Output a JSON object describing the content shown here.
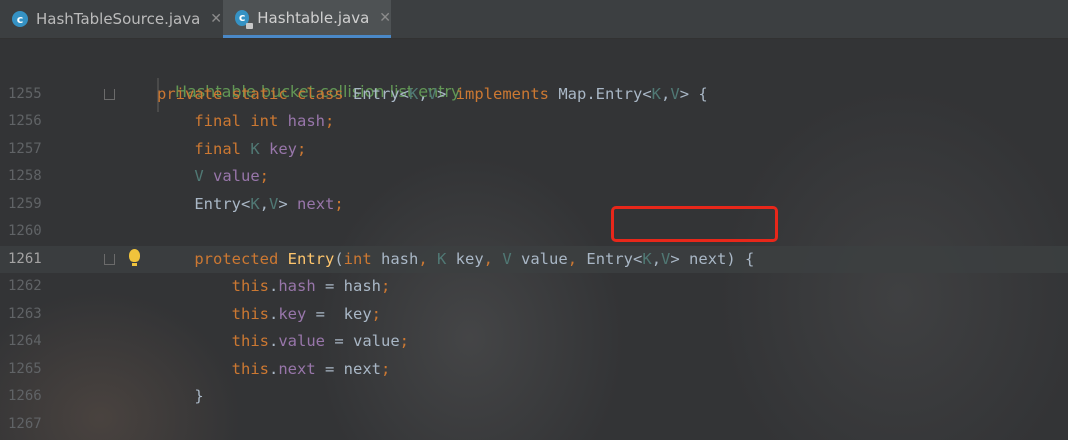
{
  "tabs": [
    {
      "label": "HashTableSource.java",
      "icon": "c",
      "active": false
    },
    {
      "label": "Hashtable.java",
      "icon": "c",
      "active": true
    }
  ],
  "close_glyph": "✕",
  "doc_comment": "Hashtable bucket collision list entry",
  "lines": [
    {
      "num": "1255",
      "tokens": [
        [
          "kw",
          "private static class "
        ],
        [
          "pl",
          "Entry<"
        ],
        [
          "ty",
          "K"
        ],
        [
          "pl",
          ","
        ],
        [
          "ty",
          "V"
        ],
        [
          "pl",
          "> "
        ],
        [
          "kw",
          "implements "
        ],
        [
          "pl",
          "Map.Entry<"
        ],
        [
          "ty",
          "K"
        ],
        [
          "pl",
          ","
        ],
        [
          "ty",
          "V"
        ],
        [
          "pl",
          "> {"
        ]
      ]
    },
    {
      "num": "1256",
      "tokens": [
        [
          "pl",
          "    "
        ],
        [
          "kw",
          "final int "
        ],
        [
          "fd",
          "hash"
        ],
        [
          "kw",
          ";"
        ]
      ]
    },
    {
      "num": "1257",
      "tokens": [
        [
          "pl",
          "    "
        ],
        [
          "kw",
          "final "
        ],
        [
          "ty",
          "K "
        ],
        [
          "fd",
          "key"
        ],
        [
          "kw",
          ";"
        ]
      ]
    },
    {
      "num": "1258",
      "tokens": [
        [
          "pl",
          "    "
        ],
        [
          "ty",
          "V "
        ],
        [
          "fd",
          "value"
        ],
        [
          "kw",
          ";"
        ]
      ]
    },
    {
      "num": "1259",
      "tokens": [
        [
          "pl",
          "    Entry<"
        ],
        [
          "ty",
          "K"
        ],
        [
          "pl",
          ","
        ],
        [
          "ty",
          "V"
        ],
        [
          "pl",
          "> "
        ],
        [
          "fd",
          "next"
        ],
        [
          "kw",
          ";"
        ]
      ]
    },
    {
      "num": "1260",
      "tokens": []
    },
    {
      "num": "1261",
      "tokens": [
        [
          "pl",
          "    "
        ],
        [
          "kw",
          "protected "
        ],
        [
          "mt",
          "Entry"
        ],
        [
          "pl",
          "("
        ],
        [
          "kw",
          "int "
        ],
        [
          "pl",
          "hash"
        ],
        [
          "kw",
          ", "
        ],
        [
          "ty",
          "K "
        ],
        [
          "pl",
          "key"
        ],
        [
          "kw",
          ", "
        ],
        [
          "ty",
          "V "
        ],
        [
          "pl",
          "value"
        ],
        [
          "kw",
          ", "
        ],
        [
          "pl",
          "Entry<"
        ],
        [
          "ty",
          "K"
        ],
        [
          "pl",
          ","
        ],
        [
          "ty",
          "V"
        ],
        [
          "pl",
          "> next) {"
        ]
      ]
    },
    {
      "num": "1262",
      "tokens": [
        [
          "pl",
          "        "
        ],
        [
          "kw",
          "this"
        ],
        [
          "pl",
          "."
        ],
        [
          "fd",
          "hash "
        ],
        [
          "pl",
          "= hash"
        ],
        [
          "kw",
          ";"
        ]
      ]
    },
    {
      "num": "1263",
      "tokens": [
        [
          "pl",
          "        "
        ],
        [
          "kw",
          "this"
        ],
        [
          "pl",
          "."
        ],
        [
          "fd",
          "key "
        ],
        [
          "pl",
          "=  key"
        ],
        [
          "kw",
          ";"
        ]
      ]
    },
    {
      "num": "1264",
      "tokens": [
        [
          "pl",
          "        "
        ],
        [
          "kw",
          "this"
        ],
        [
          "pl",
          "."
        ],
        [
          "fd",
          "value "
        ],
        [
          "pl",
          "= value"
        ],
        [
          "kw",
          ";"
        ]
      ]
    },
    {
      "num": "1265",
      "tokens": [
        [
          "pl",
          "        "
        ],
        [
          "kw",
          "this"
        ],
        [
          "pl",
          "."
        ],
        [
          "fd",
          "next "
        ],
        [
          "pl",
          "= next"
        ],
        [
          "kw",
          ";"
        ]
      ]
    },
    {
      "num": "1266",
      "tokens": [
        [
          "pl",
          "    }"
        ]
      ]
    },
    {
      "num": "1267",
      "tokens": []
    }
  ],
  "current_line": "1261",
  "colors": {
    "keyword": "#cc7832",
    "type_param": "#507874",
    "field": "#9876aa",
    "method": "#ffc66d",
    "plain": "#a9b7c6",
    "comment": "#629755",
    "highlight_box": "#e8271a"
  }
}
